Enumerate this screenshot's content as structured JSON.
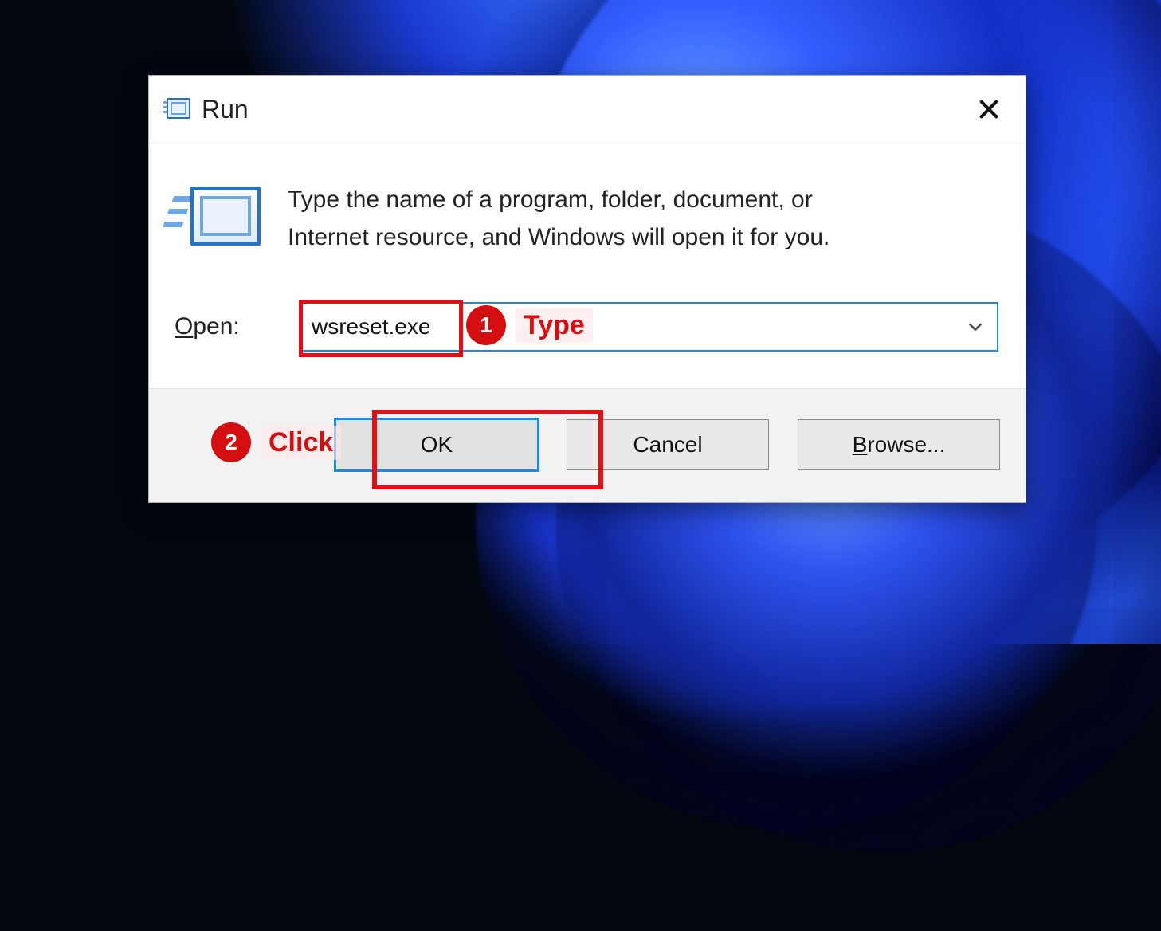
{
  "dialog": {
    "title": "Run",
    "description": "Type the name of a program, folder, document, or Internet resource, and Windows will open it for you.",
    "open_label_prefix": "O",
    "open_label_rest": "pen:",
    "input_value": "wsreset.exe",
    "buttons": {
      "ok": "OK",
      "cancel": "Cancel",
      "browse_prefix": "B",
      "browse_rest": "rowse..."
    }
  },
  "annotations": {
    "step1_number": "1",
    "step1_label": "Type",
    "step2_number": "2",
    "step2_label": "Click"
  }
}
